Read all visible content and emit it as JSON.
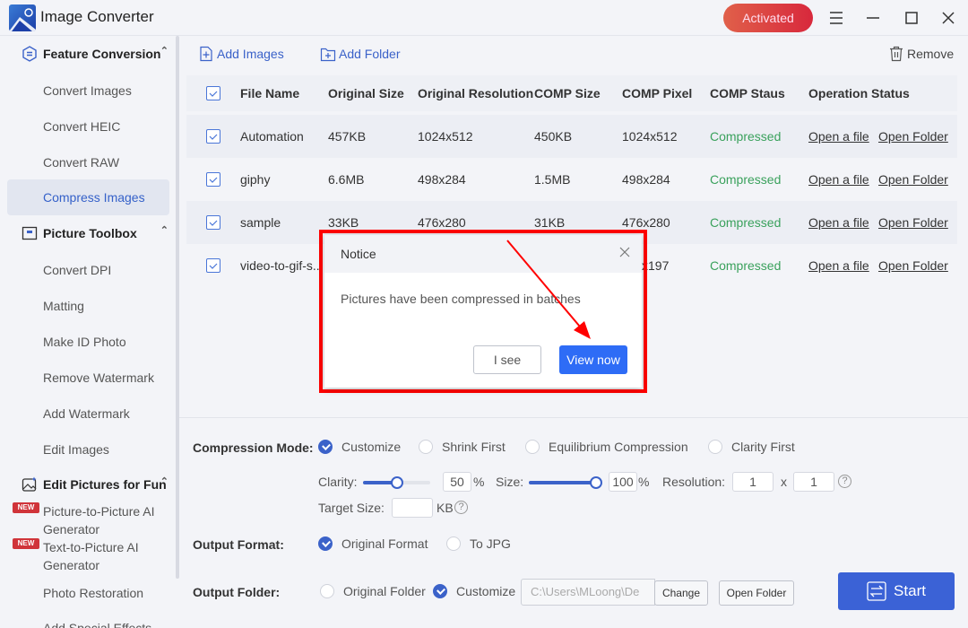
{
  "app": {
    "title": "Image Converter",
    "activated_label": "Activated"
  },
  "window_controls": [
    "menu-icon",
    "minimize-icon",
    "maximize-icon",
    "close-icon"
  ],
  "sidebar": {
    "groups": [
      {
        "label": "Feature Conversion",
        "icon": "convert-icon",
        "items": [
          {
            "label": "Convert Images"
          },
          {
            "label": "Convert HEIC"
          },
          {
            "label": "Convert RAW"
          },
          {
            "label": "Compress Images",
            "active": true
          }
        ]
      },
      {
        "label": "Picture Toolbox",
        "icon": "toolbox-icon",
        "items": [
          {
            "label": "Convert DPI"
          },
          {
            "label": "Matting"
          },
          {
            "label": "Make ID Photo"
          },
          {
            "label": "Remove Watermark"
          },
          {
            "label": "Add Watermark"
          },
          {
            "label": "Edit Images"
          }
        ]
      },
      {
        "label": "Edit Pictures for Fun",
        "icon": "picture-sparkle-icon",
        "items": [
          {
            "label_line1": "Picture-to-Picture AI",
            "label_line2": "Generator",
            "badge": "NEW"
          },
          {
            "label_line1": "Text-to-Picture AI",
            "label_line2": "Generator",
            "badge": "NEW"
          },
          {
            "label": "Photo Restoration"
          },
          {
            "label": "Add Special Effects"
          }
        ]
      }
    ]
  },
  "toolbar": {
    "add_images": "Add Images",
    "add_folder": "Add Folder",
    "remove": "Remove"
  },
  "table": {
    "columns": [
      "File Name",
      "Original Size",
      "Original Resolution",
      "COMP Size",
      "COMP Pixel",
      "COMP Staus",
      "Operation Status"
    ],
    "rows": [
      {
        "name": "Automation",
        "orig_size": "457KB",
        "orig_res": "1024x512",
        "comp_size": "450KB",
        "comp_pixel": "1024x512",
        "status": "Compressed",
        "open_file": "Open a file",
        "open_folder": "Open Folder",
        "checked": true
      },
      {
        "name": "giphy",
        "orig_size": "6.6MB",
        "orig_res": "498x284",
        "comp_size": "1.5MB",
        "comp_pixel": "498x284",
        "status": "Compressed",
        "open_file": "Open a file",
        "open_folder": "Open Folder",
        "checked": true
      },
      {
        "name": "sample",
        "orig_size": "33KB",
        "orig_res": "476x280",
        "comp_size": "31KB",
        "comp_pixel": "476x280",
        "status": "Compressed",
        "open_file": "Open a file",
        "open_folder": "Open Folder",
        "checked": true
      },
      {
        "name": "video-to-gif-s...",
        "orig_size": "",
        "orig_res": "",
        "comp_size": "",
        "comp_pixel": "x197",
        "status": "Compressed",
        "open_file": "Open a file",
        "open_folder": "Open Folder",
        "checked": true
      }
    ]
  },
  "settings": {
    "compression_mode_label": "Compression Mode:",
    "modes": [
      {
        "label": "Customize",
        "selected": true
      },
      {
        "label": "Shrink First",
        "selected": false
      },
      {
        "label": "Equilibrium Compression",
        "selected": false
      },
      {
        "label": "Clarity First",
        "selected": false
      }
    ],
    "clarity_label": "Clarity:",
    "clarity_value": "50",
    "clarity_fraction": 0.5,
    "size_label": "Size:",
    "size_value": "100",
    "size_fraction": 1.0,
    "percent": "%",
    "resolution_label": "Resolution:",
    "resolution_w": "1",
    "resolution_x": "x",
    "resolution_h": "1",
    "target_size_label": "Target Size:",
    "target_size_value": "",
    "target_size_unit": "KB",
    "output_format_label": "Output Format:",
    "formats": [
      {
        "label": "Original Format",
        "selected": true
      },
      {
        "label": "To JPG",
        "selected": false
      }
    ],
    "output_folder_label": "Output Folder:",
    "folders": [
      {
        "label": "Original Folder",
        "selected": false
      },
      {
        "label": "Customize",
        "selected": true
      }
    ],
    "folder_path": "C:\\Users\\MLoong\\De",
    "change_label": "Change",
    "open_folder_label": "Open Folder",
    "start_label": "Start"
  },
  "dialog": {
    "title": "Notice",
    "message": "Pictures have been compressed in batches",
    "cancel_label": "I see",
    "confirm_label": "View now"
  },
  "colors": {
    "accent": "#3b62c9",
    "primary_button": "#2e6cf6",
    "success": "#3aa15c",
    "activated_badge": "#d8283c",
    "annotation": "#ff0000"
  }
}
